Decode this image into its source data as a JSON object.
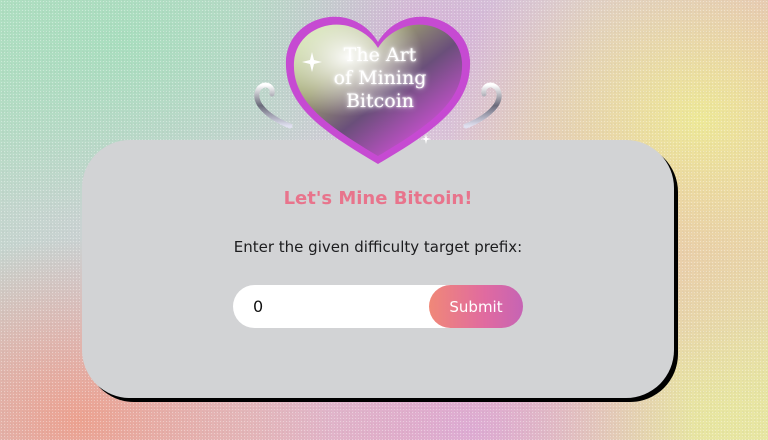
{
  "logo": {
    "line1": "The Art",
    "line2": "of Mining",
    "line3": "Bitcoin",
    "icon": "chrome-heart-icon"
  },
  "card": {
    "title": "Let's Mine Bitcoin!",
    "prompt": "Enter the given difficulty target prefix:",
    "input_value": "0",
    "submit_label": "Submit"
  },
  "colors": {
    "title": "#e8748c",
    "card_bg": "#d2d3d5",
    "button_start": "#f08878",
    "button_end": "#c664b4"
  }
}
